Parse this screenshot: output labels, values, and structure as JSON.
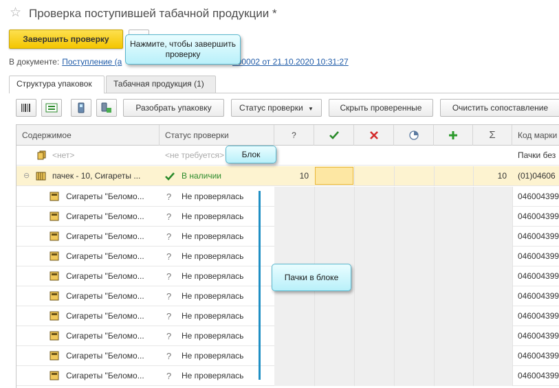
{
  "header": {
    "title": "Проверка поступившей табачной продукции *"
  },
  "toolbar_main": {
    "finish_label": "Завершить проверку"
  },
  "document": {
    "prefix": "В документе:",
    "link_visible": "Поступление (а",
    "link_tail": "000002 от 21.10.2020 10:31:27"
  },
  "tabs": [
    {
      "label": "Структура упаковок",
      "active": true
    },
    {
      "label": "Табачная продукция (1)",
      "active": false
    }
  ],
  "grid_toolbar": {
    "icons": [
      "barcode-scan-icon",
      "add-code-icon",
      "scanner-icon",
      "tsd-icon"
    ],
    "unpack_label": "Разобрать упаковку",
    "status_label": "Статус проверки",
    "hide_label": "Скрыть проверенные",
    "clear_label": "Очистить сопоставление"
  },
  "columns": {
    "content": "Содержимое",
    "status": "Статус проверки",
    "q": "?",
    "sum": "Σ",
    "code": "Код марки"
  },
  "rows": {
    "empty": {
      "content": "<нет>",
      "status": "<не требуется>",
      "code": "Пачки без"
    },
    "block": {
      "content": "пачек - 10, Сигареты ...",
      "status": "В наличии",
      "q_val": "10",
      "sum_val": "10",
      "code": "(01)04606"
    },
    "items": [
      {
        "content": "Сигареты \"Беломо...",
        "status": "Не проверялась",
        "code": "046004399"
      },
      {
        "content": "Сигареты \"Беломо...",
        "status": "Не проверялась",
        "code": "046004399"
      },
      {
        "content": "Сигареты \"Беломо...",
        "status": "Не проверялась",
        "code": "046004399"
      },
      {
        "content": "Сигареты \"Беломо...",
        "status": "Не проверялась",
        "code": "046004399"
      },
      {
        "content": "Сигареты \"Беломо...",
        "status": "Не проверялась",
        "code": "046004399"
      },
      {
        "content": "Сигареты \"Беломо...",
        "status": "Не проверялась",
        "code": "046004399"
      },
      {
        "content": "Сигареты \"Беломо...",
        "status": "Не проверялась",
        "code": "046004399"
      },
      {
        "content": "Сигареты \"Беломо...",
        "status": "Не проверялась",
        "code": "046004399"
      },
      {
        "content": "Сигареты \"Беломо...",
        "status": "Не проверялась",
        "code": "046004399"
      },
      {
        "content": "Сигареты \"Беломо...",
        "status": "Не проверялась",
        "code": "046004399"
      }
    ]
  },
  "callouts": {
    "finish_hint": "Нажмите, чтобы завершить проверку",
    "block": "Блок",
    "packs": "Пачки в блоке"
  },
  "colors": {
    "accent_yellow": "#f4c600",
    "link": "#1f5ba8",
    "callout": "#b9f0fa",
    "ok_green": "#2a8a2a",
    "error_red": "#d42a2a"
  }
}
